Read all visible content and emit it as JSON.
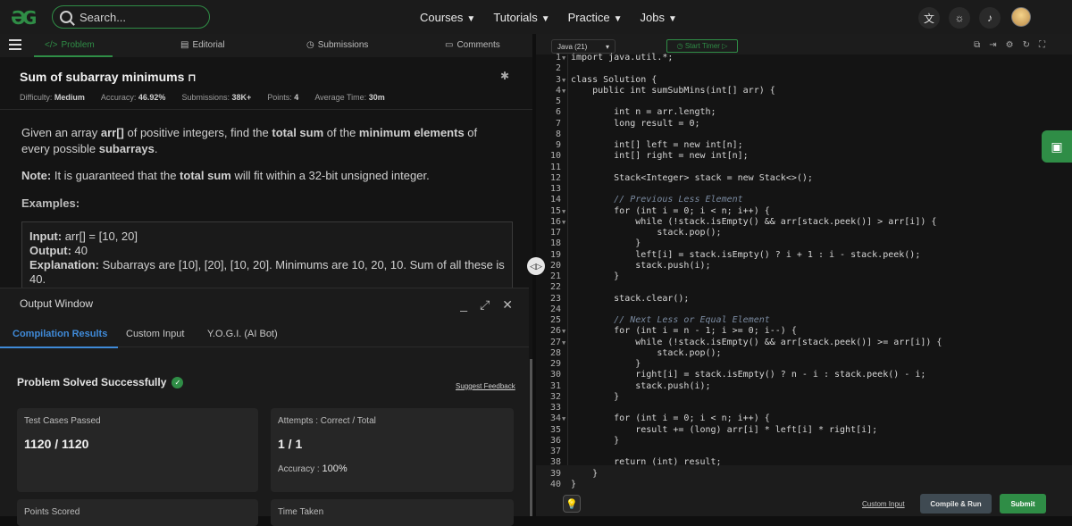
{
  "topbar": {
    "search_placeholder": "Search...",
    "nav": [
      "Courses",
      "Tutorials",
      "Practice",
      "Jobs"
    ]
  },
  "problem_tabs": [
    "Problem",
    "Editorial",
    "Submissions",
    "Comments"
  ],
  "problem": {
    "title": "Sum of subarray minimums",
    "difficulty_label": "Difficulty:",
    "difficulty": "Medium",
    "accuracy_label": "Accuracy:",
    "accuracy": "46.92%",
    "submissions_label": "Submissions:",
    "submissions": "38K+",
    "points_label": "Points:",
    "points": "4",
    "avg_time_label": "Average Time:",
    "avg_time": "30m",
    "desc_1": "Given an array ",
    "desc_arr": "arr[]",
    "desc_2": " of positive integers, find the ",
    "desc_total": "total sum",
    "desc_3": " of the ",
    "desc_min": "minimum elements",
    "desc_4": " of every possible ",
    "desc_sub": "subarrays",
    "desc_5": ".",
    "note_label": "Note:",
    "note_1": " It is guaranteed that the ",
    "note_total": "total sum",
    "note_2": " will fit within a 32-bit unsigned integer.",
    "examples_heading": "Examples:",
    "example_input_label": "Input:",
    "example_input": " arr[] = [10, 20]",
    "example_output_label": "Output:",
    "example_output": " 40",
    "example_expl_label": "Explanation:",
    "example_expl": " Subarrays are [10], [20], [10, 20]. Minimums are 10, 20, 10. Sum of all these is 40."
  },
  "output_window": {
    "title": "Output Window",
    "tabs": [
      "Compilation Results",
      "Custom Input",
      "Y.O.G.I. (AI Bot)"
    ],
    "status": "Problem Solved Successfully",
    "suggest_feedback": "Suggest Feedback",
    "test_cases_label": "Test Cases Passed",
    "test_cases_value": "1120 / 1120",
    "attempts_label": "Attempts : Correct / Total",
    "attempts_value": "1 / 1",
    "accuracy_label": "Accuracy :",
    "accuracy_value": "100%",
    "points_label": "Points Scored",
    "time_label": "Time Taken"
  },
  "editor": {
    "language": "Java (21)",
    "timer_label": "Start Timer",
    "custom_input": "Custom Input",
    "compile_run": "Compile & Run",
    "submit": "Submit",
    "lines": [
      "import java.util.*;",
      "",
      "class Solution {",
      "    public int sumSubMins(int[] arr) {",
      "",
      "        int n = arr.length;",
      "        long result = 0;",
      "",
      "        int[] left = new int[n];",
      "        int[] right = new int[n];",
      "",
      "        Stack<Integer> stack = new Stack<>();",
      "",
      "        // Previous Less Element",
      "        for (int i = 0; i < n; i++) {",
      "            while (!stack.isEmpty() && arr[stack.peek()] > arr[i]) {",
      "                stack.pop();",
      "            }",
      "            left[i] = stack.isEmpty() ? i + 1 : i - stack.peek();",
      "            stack.push(i);",
      "        }",
      "",
      "        stack.clear();",
      "",
      "        // Next Less or Equal Element",
      "        for (int i = n - 1; i >= 0; i--) {",
      "            while (!stack.isEmpty() && arr[stack.peek()] >= arr[i]) {",
      "                stack.pop();",
      "            }",
      "            right[i] = stack.isEmpty() ? n - i : stack.peek() - i;",
      "            stack.push(i);",
      "        }",
      "",
      "        for (int i = 0; i < n; i++) {",
      "            result += (long) arr[i] * left[i] * right[i];",
      "        }",
      "",
      "        return (int) result;",
      "    }",
      "}"
    ]
  }
}
